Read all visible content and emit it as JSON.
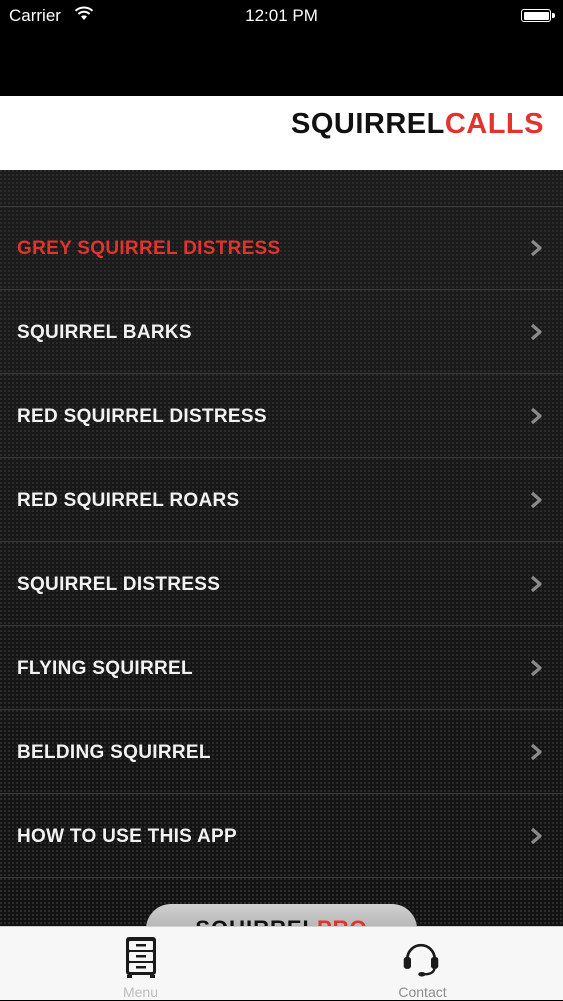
{
  "status_bar": {
    "carrier": "Carrier",
    "time": "12:01 PM",
    "battery_level": 1.0
  },
  "header": {
    "logo_part1": "SQUIRREL",
    "logo_part2": "CALLS"
  },
  "menu": {
    "items": [
      {
        "label": "GREY SQUIRREL DISTRESS",
        "active": true
      },
      {
        "label": "SQUIRREL BARKS",
        "active": false
      },
      {
        "label": "RED SQUIRREL DISTRESS",
        "active": false
      },
      {
        "label": "RED SQUIRREL ROARS",
        "active": false
      },
      {
        "label": "SQUIRREL DISTRESS",
        "active": false
      },
      {
        "label": "FLYING SQUIRREL",
        "active": false
      },
      {
        "label": "BELDING SQUIRREL",
        "active": false
      },
      {
        "label": "HOW TO USE THIS APP",
        "active": false
      }
    ]
  },
  "promo": {
    "part1": "SQUIRREL",
    "part2": "PRO"
  },
  "tab_bar": {
    "menu_label": "Menu",
    "contact_label": "Contact"
  },
  "colors": {
    "accent": "#e2332e",
    "menu_text": "#f2f2f2",
    "header_bg": "#ffffff",
    "tab_bar_bg": "#f7f7f7"
  },
  "icons": {
    "wifi": "wifi-icon",
    "battery": "battery-icon",
    "chevron": "chevron-right-icon",
    "menu_tab": "file-cabinet-icon",
    "contact_tab": "headset-icon"
  }
}
